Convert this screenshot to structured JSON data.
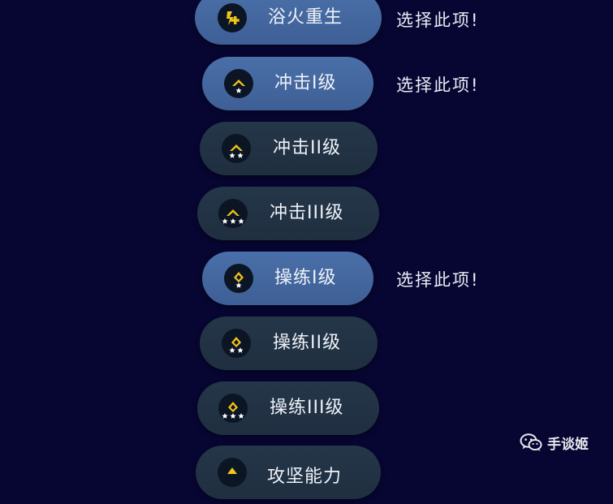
{
  "options": [
    {
      "label": "浴火重生",
      "selected": true,
      "icon": "phoenix-rebirth-icon",
      "stars": 0
    },
    {
      "label": "冲击I级",
      "selected": true,
      "icon": "chevron-rank-icon",
      "stars": 1
    },
    {
      "label": "冲击II级",
      "selected": false,
      "icon": "chevron-rank-icon",
      "stars": 2
    },
    {
      "label": "冲击III级",
      "selected": false,
      "icon": "chevron-rank-icon",
      "stars": 3
    },
    {
      "label": "操练I级",
      "selected": true,
      "icon": "diamond-rank-icon",
      "stars": 1
    },
    {
      "label": "操练II级",
      "selected": false,
      "icon": "diamond-rank-icon",
      "stars": 2
    },
    {
      "label": "操练III级",
      "selected": false,
      "icon": "diamond-rank-icon",
      "stars": 3
    },
    {
      "label": "攻坚能力",
      "selected": false,
      "icon": "rank-icon",
      "stars": 0
    }
  ],
  "annotations": {
    "choose_text": "选择此项!"
  },
  "watermark": {
    "text": "手谈姬",
    "icon": "wechat-icon"
  },
  "colors": {
    "background": "#070632",
    "selected_pill": "#4468a0",
    "normal_pill": "#233345",
    "icon_gold": "#f2c418",
    "text": "#eef2f8"
  }
}
